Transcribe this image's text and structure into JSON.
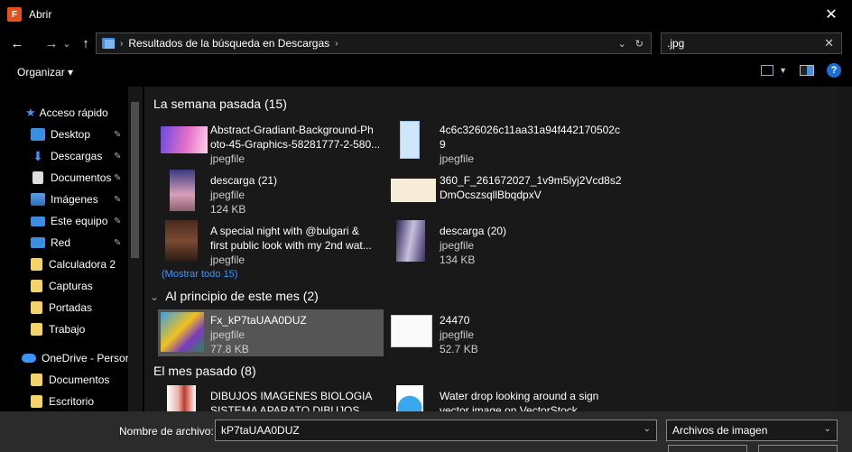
{
  "window": {
    "title": "Abrir",
    "app_badge": "F"
  },
  "nav": {
    "back": "←",
    "forward": "→",
    "recent": "⌄",
    "up": "↑",
    "breadcrumb": "Resultados de la búsqueda en Descargas",
    "dropdown": "⌄",
    "refresh": "↻"
  },
  "search": {
    "value": ".jpg",
    "clear": "✕"
  },
  "toolbar": {
    "organize": "Organizar",
    "organize_arrow": "▾",
    "help": "?"
  },
  "sidebar": {
    "items": [
      {
        "label": "Acceso rápido",
        "icon": "star-icon"
      },
      {
        "label": "Desktop",
        "icon": "desktop-icon",
        "pinned": true
      },
      {
        "label": "Descargas",
        "icon": "download-icon",
        "pinned": true
      },
      {
        "label": "Documentos",
        "icon": "document-icon",
        "pinned": true
      },
      {
        "label": "Imágenes",
        "icon": "image-icon",
        "pinned": true
      },
      {
        "label": "Este equipo",
        "icon": "computer-icon",
        "pinned": true
      },
      {
        "label": "Red",
        "icon": "network-icon",
        "pinned": true
      },
      {
        "label": "Calculadora 2",
        "icon": "folder-icon"
      },
      {
        "label": "Capturas",
        "icon": "folder-icon"
      },
      {
        "label": "Portadas",
        "icon": "folder-icon"
      },
      {
        "label": "Trabajo",
        "icon": "folder-icon"
      },
      {
        "label": "OneDrive - Persor",
        "icon": "cloud-icon"
      },
      {
        "label": "Documentos",
        "icon": "folder-icon"
      },
      {
        "label": "Escritorio",
        "icon": "folder-icon"
      }
    ],
    "pin_glyph": "📌"
  },
  "groups": [
    {
      "title": "La semana pasada (15)",
      "more": "(Mostrar todo 15)"
    },
    {
      "title": "Al principio de este mes (2)",
      "chevron": "⌄"
    },
    {
      "title": "El mes pasado (8)"
    }
  ],
  "files": [
    {
      "name1": "Abstract-Gradiant-Background-Ph",
      "name2": "oto-45-Graphics-58281777-2-580...",
      "type": "jpegfile",
      "size": ""
    },
    {
      "name1": "4c6c326026c11aa31a94f442170502c",
      "name2": "9",
      "type": "jpegfile",
      "size": ""
    },
    {
      "name1": "descarga (21)",
      "name2": "",
      "type": "jpegfile",
      "size": "124 KB"
    },
    {
      "name1": "360_F_261672027_1v9m5lyj2Vcd8s2",
      "name2": "DmOcszsqllBbqdpxV",
      "type": "jpegfile",
      "size": ""
    },
    {
      "name1": "A special night with @bulgari &",
      "name2": "first public look with my 2nd wat...",
      "type": "jpegfile",
      "size": ""
    },
    {
      "name1": "descarga (20)",
      "name2": "",
      "type": "jpegfile",
      "size": "134 KB"
    },
    {
      "name1": "Fx_kP7taUAA0DUZ",
      "name2": "",
      "type": "jpegfile",
      "size": "77.8 KB"
    },
    {
      "name1": "24470",
      "name2": "",
      "type": "jpegfile",
      "size": "52.7 KB"
    },
    {
      "name1": "DIBUJOS IMAGENES BIOLOGIA",
      "name2": "SISTEMA APARATO  DIBUJOS DEL ...",
      "type": "",
      "size": ""
    },
    {
      "name1": "Water drop looking around a sign",
      "name2": "vector image on VectorStock",
      "type": "",
      "size": ""
    }
  ],
  "bottom": {
    "filename_label": "Nombre de archivo:",
    "filename_value": "kP7taUAA0DUZ",
    "filetype": "Archivos de imagen",
    "caret": "⌄"
  }
}
